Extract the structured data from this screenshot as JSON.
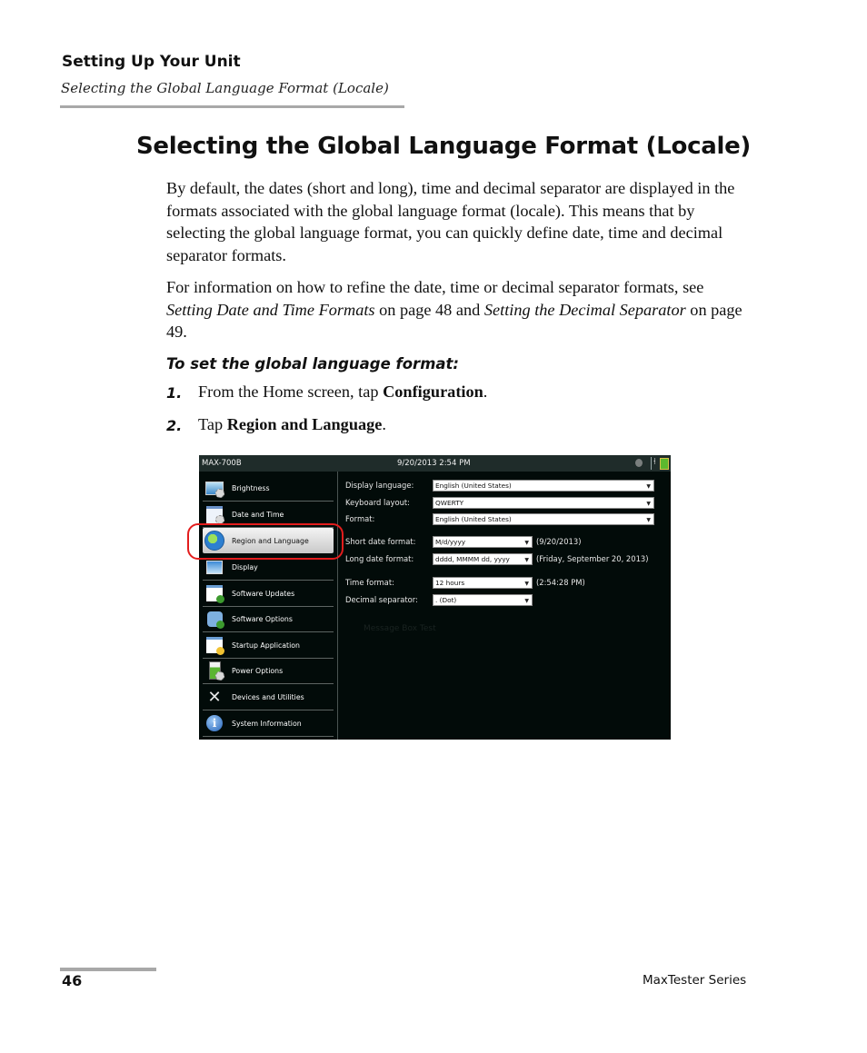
{
  "header": {
    "chapter": "Setting Up Your Unit",
    "section": "Selecting the Global Language Format (Locale)"
  },
  "title": "Selecting the Global Language Format (Locale)",
  "paragraphs": {
    "p1": "By default, the dates (short and long), time and decimal separator are displayed in the formats associated with the global language format (locale). This means that by selecting the global language format, you can quickly define date, time and decimal separator formats.",
    "p2_before": "For information on how to refine the date, time or decimal separator formats, see ",
    "p2_link1": "Setting Date and Time Formats",
    "p2_mid": " on page 48 and ",
    "p2_link2": "Setting the Decimal Separator",
    "p2_after": " on page 49."
  },
  "procedure": {
    "title": "To set the global language format:",
    "steps": [
      {
        "num": "1.",
        "before": "From the Home screen, tap ",
        "bold": "Configuration",
        "after": "."
      },
      {
        "num": "2.",
        "before": "Tap ",
        "bold": "Region and Language",
        "after": "."
      }
    ]
  },
  "screenshot": {
    "statusbar": {
      "model": "MAX-700B",
      "datetime": "9/20/2013 2:54 PM",
      "icons": [
        "bluetooth-icon",
        "power-plug-icon",
        "battery-icon"
      ]
    },
    "sidebar": {
      "selected": "Region and Language",
      "items": [
        {
          "label": "Brightness",
          "icon": "monitor-gear-icon"
        },
        {
          "label": "Date and Time",
          "icon": "calendar-gear-icon"
        },
        {
          "label": "Region and Language",
          "icon": "globe-icon"
        },
        {
          "label": "Display",
          "icon": "display-icon"
        },
        {
          "label": "Software Updates",
          "icon": "window-download-icon"
        },
        {
          "label": "Software Options",
          "icon": "puzzle-add-icon"
        },
        {
          "label": "Startup Application",
          "icon": "window-star-icon"
        },
        {
          "label": "Power Options",
          "icon": "battery-gear-icon"
        },
        {
          "label": "Devices and Utilities",
          "icon": "tools-icon"
        },
        {
          "label": "System Information",
          "icon": "info-icon"
        }
      ]
    },
    "settings": {
      "display_language": {
        "label": "Display language:",
        "value": "English (United States)"
      },
      "keyboard_layout": {
        "label": "Keyboard layout:",
        "value": "QWERTY"
      },
      "format": {
        "label": "Format:",
        "value": "English (United States)"
      },
      "short_date": {
        "label": "Short date format:",
        "value": "M/d/yyyy",
        "preview": "(9/20/2013)"
      },
      "long_date": {
        "label": "Long date format:",
        "value": "dddd, MMMM dd, yyyy",
        "preview": "(Friday, September 20, 2013)"
      },
      "time_format": {
        "label": "Time format:",
        "value": "12 hours",
        "preview": "(2:54:28 PM)"
      },
      "decimal_separator": {
        "label": "Decimal separator:",
        "value": ". (Dot)"
      }
    },
    "background_ghost_text": "Message Box Test",
    "highlight_color": "#e31d1d"
  },
  "footer": {
    "page_number": "46",
    "product": "MaxTester Series"
  }
}
